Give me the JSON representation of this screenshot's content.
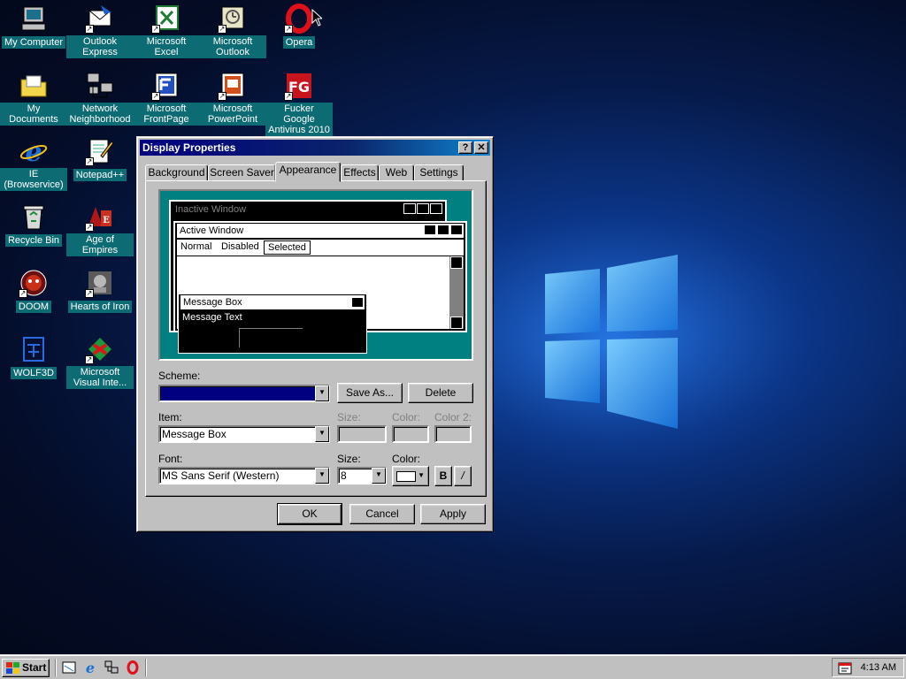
{
  "desktop": {
    "icons": [
      {
        "label": "My Computer",
        "icon": "my-computer-icon"
      },
      {
        "label": "Outlook Express",
        "icon": "outlook-express-icon"
      },
      {
        "label": "Microsoft Excel",
        "icon": "excel-icon"
      },
      {
        "label": "Microsoft Outlook",
        "icon": "outlook-icon"
      },
      {
        "label": "Opera",
        "icon": "opera-icon"
      },
      {
        "label": "My Documents",
        "icon": "my-documents-icon"
      },
      {
        "label": "Network Neighborhood",
        "icon": "network-icon"
      },
      {
        "label": "Microsoft FrontPage",
        "icon": "frontpage-icon"
      },
      {
        "label": "Microsoft PowerPoint",
        "icon": "powerpoint-icon"
      },
      {
        "label": "Fucker Google Antivirus 2010",
        "icon": "antivirus-icon"
      },
      {
        "label": "IE (Browservice)",
        "icon": "internet-explorer-icon"
      },
      {
        "label": "Notepad++",
        "icon": "notepad-icon"
      },
      {
        "label": "Recycle Bin",
        "icon": "recycle-bin-icon"
      },
      {
        "label": "Age of Empires",
        "icon": "age-of-empires-icon"
      },
      {
        "label": "DOOM",
        "icon": "doom-icon"
      },
      {
        "label": "Hearts of Iron",
        "icon": "hearts-of-iron-icon"
      },
      {
        "label": "WOLF3D",
        "icon": "wolf3d-icon"
      },
      {
        "label": "Microsoft Visual Inte...",
        "icon": "visual-interdev-icon"
      }
    ]
  },
  "dialog": {
    "title": "Display Properties",
    "help_button": "?",
    "close_button": "✕",
    "tabs": [
      "Background",
      "Screen Saver",
      "Appearance",
      "Effects",
      "Web",
      "Settings"
    ],
    "active_tab": "Appearance",
    "preview": {
      "inactive_title": "Inactive Window",
      "active_title": "Active Window",
      "menu_items": [
        "Normal",
        "Disabled",
        "Selected"
      ],
      "message_box_title": "Message Box",
      "message_text": "Message Text"
    },
    "scheme_label": "Scheme:",
    "scheme_value": "",
    "save_as_button": "Save As...",
    "delete_button": "Delete",
    "item_label": "Item:",
    "item_value": "Message Box",
    "item_size_label": "Size:",
    "item_color_label": "Color:",
    "item_color2_label": "Color 2:",
    "font_label": "Font:",
    "font_value": "MS Sans Serif (Western)",
    "font_size_label": "Size:",
    "font_size_value": "8",
    "font_color_label": "Color:",
    "bold_button": "B",
    "italic_button": "/",
    "ok_button": "OK",
    "cancel_button": "Cancel",
    "apply_button": "Apply"
  },
  "taskbar": {
    "start_label": "Start",
    "quick_launch": [
      "show-desktop-icon",
      "internet-explorer-icon",
      "network-icon",
      "opera-icon"
    ],
    "clock": "4:13 AM"
  },
  "colors": {
    "desktop_label_bg": "#0d6b74",
    "title_bar": "#000080",
    "scheme_field": "#000080",
    "preview_background": "#008080"
  }
}
